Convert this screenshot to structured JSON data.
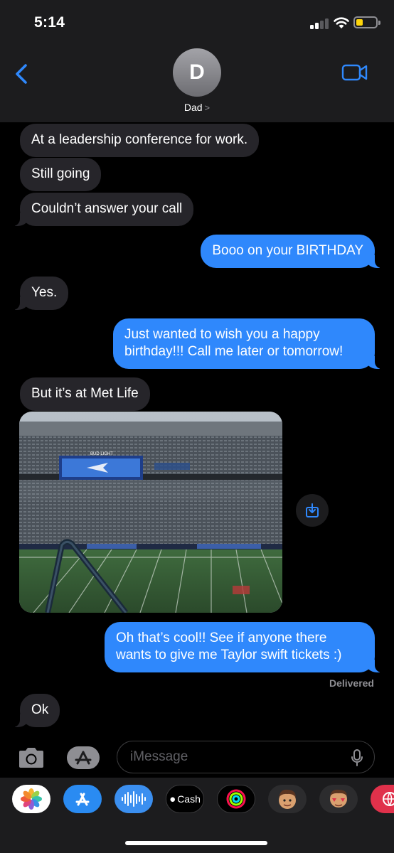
{
  "status_bar": {
    "time": "5:14"
  },
  "header": {
    "contact_initial": "D",
    "contact_name": "Dad",
    "contact_chevron": ">"
  },
  "messages": [
    {
      "from": "them",
      "text": "At a leadership conference for work."
    },
    {
      "from": "them",
      "text": "Still going"
    },
    {
      "from": "them",
      "text": "Couldn’t answer your call"
    },
    {
      "from": "me",
      "text": "Booo on your BIRTHDAY"
    },
    {
      "from": "them",
      "text": "Yes."
    },
    {
      "from": "me",
      "text": "Just wanted to wish you a happy birthday!!! Call me later or tomorrow!"
    },
    {
      "from": "them",
      "text": "But it’s at Met Life"
    },
    {
      "from": "me",
      "text": "Oh that’s cool!! See if anyone there wants to give me Taylor swift tickets :)"
    },
    {
      "from": "them",
      "text": "Ok"
    }
  ],
  "photo": {
    "scoreboard_text": "BUD LIGHT"
  },
  "delivered_label": "Delivered",
  "composer": {
    "placeholder": "iMessage"
  },
  "app_drawer": {
    "apps": [
      "photos-icon",
      "app-store-icon",
      "audio-icon",
      "apple-cash-icon",
      "activity-icon",
      "memoji-icon",
      "memoji-stickers-icon",
      "web-icon"
    ],
    "cash_label": "Cash"
  },
  "colors": {
    "outgoing_bubble": "#2f88fc",
    "incoming_bubble": "#26252a",
    "accent": "#2f88fc"
  }
}
